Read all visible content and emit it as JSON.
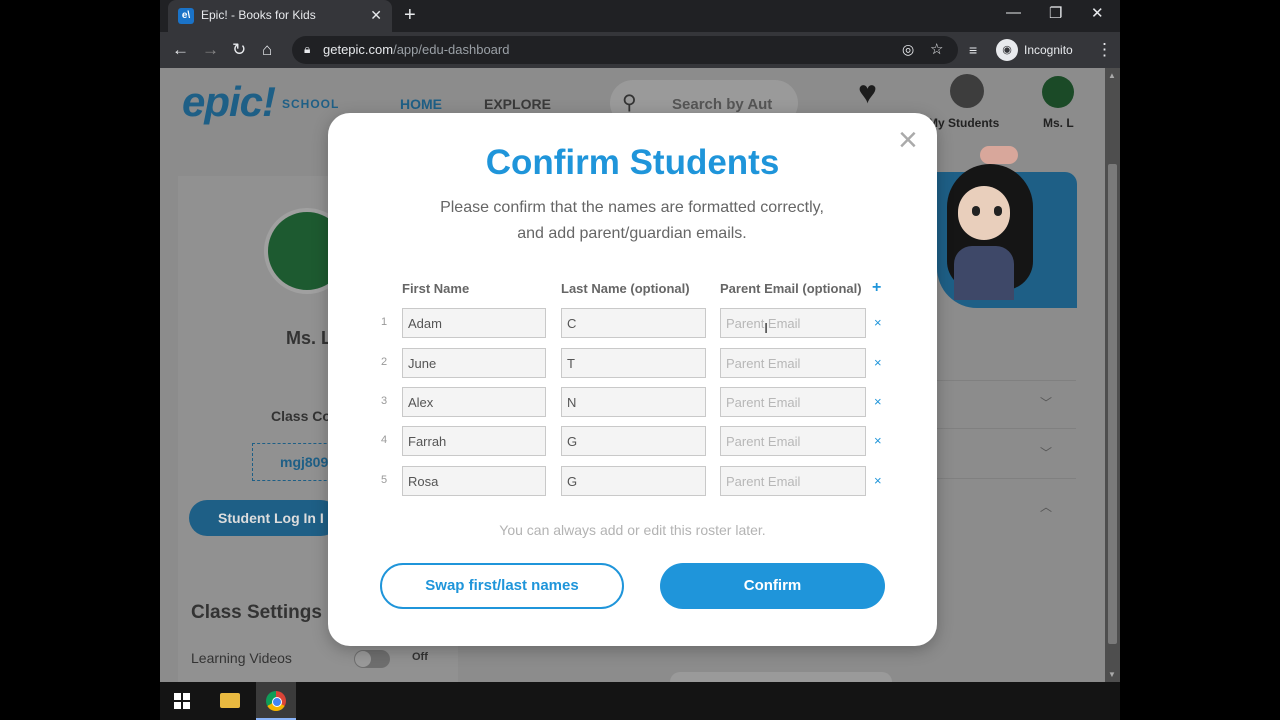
{
  "browser": {
    "tab_title": "Epic! - Books for Kids",
    "tab_favicon": "e\\",
    "url_host": "getepic.com",
    "url_path": "/app/edu-dashboard",
    "incognito_label": "Incognito"
  },
  "page": {
    "logo": "epic!",
    "logo_sub": "SCHOOL",
    "nav_home": "HOME",
    "nav_explore": "EXPLORE",
    "search_placeholder": "Search by Aut",
    "my_students": "My Students",
    "user_name_top": "Ms. L",
    "card_name": "Ms. L",
    "class_code_label": "Class Co",
    "class_code_value": "mgj809",
    "student_login": "Student Log In I",
    "class_settings": "Class Settings",
    "learning_videos": "Learning Videos",
    "toggle_state": "Off"
  },
  "modal": {
    "title": "Confirm Students",
    "subtitle_line1": "Please confirm that the names are formatted correctly,",
    "subtitle_line2": "and add parent/guardian emails.",
    "col_first": "First Name",
    "col_last": "Last Name (optional)",
    "col_email": "Parent Email (optional)",
    "add_col": "+",
    "email_placeholder": "Parent Email",
    "remove_symbol": "×",
    "rows": [
      {
        "num": "1",
        "first": "Adam",
        "last": "C"
      },
      {
        "num": "2",
        "first": "June",
        "last": "T"
      },
      {
        "num": "3",
        "first": "Alex",
        "last": "N"
      },
      {
        "num": "4",
        "first": "Farrah",
        "last": "G"
      },
      {
        "num": "5",
        "first": "Rosa",
        "last": "G"
      }
    ],
    "note": "You can always add or edit this roster later.",
    "swap_button": "Swap first/last names",
    "confirm_button": "Confirm",
    "close_symbol": "×"
  },
  "colors": {
    "accent": "#1f95da",
    "overlay": "#8c8c8c"
  },
  "icons": [
    "back-arrow-icon",
    "forward-arrow-icon",
    "reload-icon",
    "home-icon",
    "lock-icon",
    "eye-off-icon",
    "star-icon",
    "media-icon",
    "incognito-icon",
    "kebab-menu-icon",
    "search-icon",
    "heart-icon",
    "students-icon",
    "close-icon",
    "windows-start-icon",
    "file-explorer-icon",
    "chrome-icon"
  ]
}
